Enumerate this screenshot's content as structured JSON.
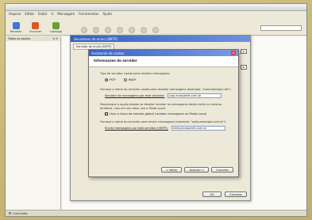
{
  "menubar": [
    "Arquivo",
    "Editar",
    "Exibir",
    "Ir",
    "Mensagem",
    "Ferramentas",
    "Ajuda"
  ],
  "toolbar": {
    "buttons": [
      {
        "label": "Receber",
        "icon": "receive-mail-icon",
        "color": "#3c78d8"
      },
      {
        "label": "Escrever",
        "icon": "compose-icon",
        "color": "#d9582b"
      },
      {
        "label": "Catálogo",
        "icon": "address-book-icon",
        "color": "#6a9e3b"
      }
    ]
  },
  "sidebar": {
    "title": "Todas as pastas"
  },
  "statusbar": {
    "text": "Concluído"
  },
  "account_dialog": {
    "title": "Servidores de envio (SMTP)",
    "tabs": [
      "Servidor de envio (SMTP)"
    ],
    "ok": "OK",
    "cancel": "Cancelar"
  },
  "wizard": {
    "title": "Assistente de contas",
    "heading": "Informações do servidor",
    "server_type_question": "Tipo de servidor usado para receber mensagens:",
    "options": [
      {
        "label": "POP",
        "selected": true
      },
      {
        "label": "IMAP",
        "selected": false
      }
    ],
    "incoming_hint": "Forneça o nome do servidor usado para receber mensagens (exemplo: \"mail.exemplo.net\").",
    "incoming_label": "Servidor de mensagens por este servidor:",
    "incoming_value": "pop.europanet.com.br",
    "global_inbox_hint": "Desmarque a opção abaixo se desejar receber as mensagens desta conta no mesmo diretório, mas em vez disso use a Pasta Local.",
    "global_inbox_label": "Usar a Caixa de entrada global (receber mensagens na Pasta Local)",
    "global_inbox_checked": true,
    "outgoing_hint": "Forneça o nome do servidor para enviar mensagens (exemplo: \"smtp.exemplo.com.br\").",
    "outgoing_label": "Enviar mensagens por este servidor (SMTP):",
    "outgoing_value": "smtp.europanet.com.br",
    "back": "< Voltar",
    "next": "Avançar >",
    "cancel": "Cancelar"
  }
}
